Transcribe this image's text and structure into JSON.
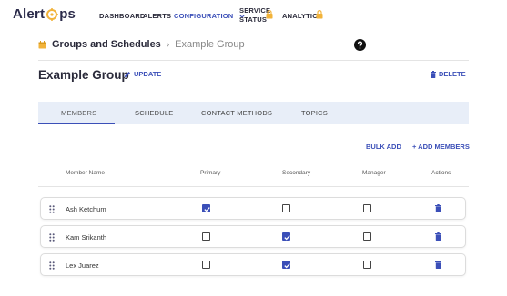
{
  "brand": {
    "logo_left": "Alert",
    "logo_right": "ps",
    "accent_color": "#3b4fb8",
    "logo_mark_color": "#f2b33a",
    "lock_color": "#f2b33a"
  },
  "nav": {
    "dashboard": "DASHBOARD",
    "alerts": "ALERTS",
    "configuration": "CONFIGURATION",
    "service_status_line1": "SERVICE",
    "service_status_line2": "STATUS",
    "analytics": "ANALYTICS"
  },
  "breadcrumb": {
    "root": "Groups and Schedules",
    "separator": "›",
    "current": "Example Group"
  },
  "page": {
    "title": "Example Group",
    "update_label": "UPDATE",
    "delete_label": "DELETE"
  },
  "tabs": [
    {
      "label": "MEMBERS",
      "active": true
    },
    {
      "label": "SCHEDULE",
      "active": false
    },
    {
      "label": "CONTACT METHODS",
      "active": false
    },
    {
      "label": "TOPICS",
      "active": false
    }
  ],
  "actions": {
    "bulk_add": "BULK ADD",
    "add_members": "+ ADD MEMBERS"
  },
  "table": {
    "headers": {
      "member_name": "Member Name",
      "primary": "Primary",
      "secondary": "Secondary",
      "manager": "Manager",
      "actions": "Actions"
    },
    "rows": [
      {
        "name": "Ash  Ketchum",
        "primary": true,
        "secondary": false,
        "manager": false
      },
      {
        "name": "Kam  Srikanth",
        "primary": false,
        "secondary": true,
        "manager": false
      },
      {
        "name": "Lex  Juarez",
        "primary": false,
        "secondary": true,
        "manager": false
      }
    ]
  },
  "icons": {
    "breadcrumb": "calendar-icon",
    "help": "help-circle-icon",
    "update": "pencil-icon",
    "delete": "trash-icon",
    "drag": "drag-handle-icon",
    "lock": "lock-icon",
    "dropdown": "chevron-down-icon"
  }
}
